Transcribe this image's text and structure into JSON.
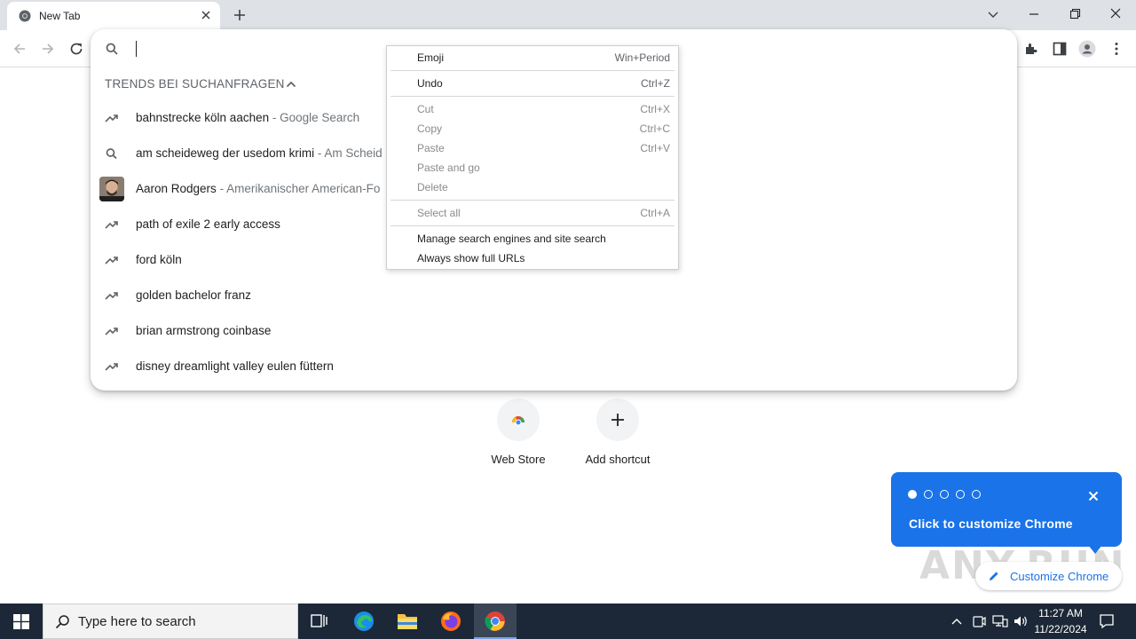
{
  "browser": {
    "tab_title": "New Tab"
  },
  "omnibox": {
    "section_header": "TRENDS BEI SUCHANFRAGEN",
    "suggestions": [
      {
        "icon": "trending-icon",
        "main": "bahnstrecke köln aachen",
        "sub": " - Google Search"
      },
      {
        "icon": "search-icon",
        "main": "am scheideweg der usedom krimi",
        "sub": " - Am Scheid"
      },
      {
        "icon": "avatar-image",
        "main": "Aaron Rodgers",
        "sub": " - Amerikanischer American-Fo"
      },
      {
        "icon": "trending-icon",
        "main": "path of exile 2 early access",
        "sub": ""
      },
      {
        "icon": "trending-icon",
        "main": "ford köln",
        "sub": ""
      },
      {
        "icon": "trending-icon",
        "main": "golden bachelor franz",
        "sub": ""
      },
      {
        "icon": "trending-icon",
        "main": "brian armstrong coinbase",
        "sub": ""
      },
      {
        "icon": "trending-icon",
        "main": "disney dreamlight valley eulen füttern",
        "sub": ""
      }
    ]
  },
  "context_menu": {
    "items": [
      {
        "label": "Emoji",
        "shortcut": "Win+Period",
        "enabled": true
      },
      {
        "label": "Undo",
        "shortcut": "Ctrl+Z",
        "enabled": true
      },
      {
        "label": "Cut",
        "shortcut": "Ctrl+X",
        "enabled": false
      },
      {
        "label": "Copy",
        "shortcut": "Ctrl+C",
        "enabled": false
      },
      {
        "label": "Paste",
        "shortcut": "Ctrl+V",
        "enabled": false
      },
      {
        "label": "Paste and go",
        "shortcut": "",
        "enabled": false
      },
      {
        "label": "Delete",
        "shortcut": "",
        "enabled": false
      },
      {
        "label": "Select all",
        "shortcut": "Ctrl+A",
        "enabled": false
      },
      {
        "label": "Manage search engines and site search",
        "shortcut": "",
        "enabled": true
      },
      {
        "label": "Always show full URLs",
        "shortcut": "",
        "enabled": true
      }
    ]
  },
  "ntp": {
    "shortcuts": [
      {
        "label": "Web Store",
        "icon": "web-store-icon"
      },
      {
        "label": "Add shortcut",
        "icon": "plus-icon"
      }
    ],
    "bubble_text": "Click to customize Chrome",
    "customize_button": "Customize Chrome",
    "watermark": "ANY.RUN"
  },
  "taskbar": {
    "search_placeholder": "Type here to search",
    "time": "11:27 AM",
    "date": "11/22/2024"
  },
  "colors": {
    "accent": "#1a73e8",
    "taskbar": "#1c2837",
    "tabstrip": "#dee1e6"
  }
}
